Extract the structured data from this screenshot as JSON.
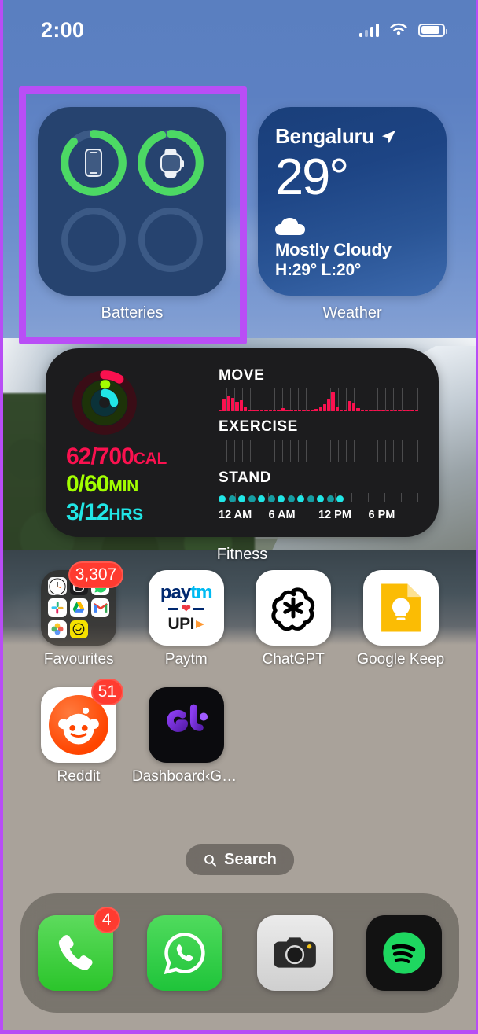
{
  "status_bar": {
    "time": "2:00",
    "cellular_icon": "cellular-signal-icon",
    "wifi_icon": "wifi-icon",
    "battery_icon": "battery-icon"
  },
  "widgets": {
    "batteries": {
      "label": "Batteries",
      "highlighted": true,
      "highlight_color": "#b94ef6",
      "rings": [
        {
          "device": "iphone",
          "icon": "iphone-icon",
          "percent": 88,
          "color": "#4cd964",
          "filled": true
        },
        {
          "device": "apple-watch",
          "icon": "apple-watch-icon",
          "percent": 95,
          "color": "#4cd964",
          "filled": true
        },
        {
          "device": "empty-slot-1",
          "icon": "",
          "percent": 0,
          "color": "#3c5a86",
          "filled": false
        },
        {
          "device": "empty-slot-2",
          "icon": "",
          "percent": 0,
          "color": "#3c5a86",
          "filled": false
        }
      ]
    },
    "weather": {
      "label": "Weather",
      "city": "Bengaluru",
      "location_icon": "location-arrow-icon",
      "temperature": "29°",
      "condition_icon": "cloud-icon",
      "condition": "Mostly Cloudy",
      "high_low": "H:29° L:20°"
    },
    "fitness": {
      "label": "Fitness",
      "move_value": "62/700",
      "move_unit": "CAL",
      "move_color": "#fa114f",
      "exercise_value": "0/60",
      "exercise_unit": "MIN",
      "exercise_color": "#a2ff00",
      "stand_value": "3/12",
      "stand_unit": "HRS",
      "stand_color": "#21e6e6",
      "move_header": "MOVE",
      "exercise_header": "EXERCISE",
      "stand_header": "STAND",
      "axis": [
        "12 AM",
        "6 AM",
        "12 PM",
        "6 PM"
      ],
      "rings": [
        {
          "name": "move-ring",
          "color": "#fa114f",
          "percent": 9
        },
        {
          "name": "exercise-ring",
          "color": "#a2ff00",
          "percent": 1
        },
        {
          "name": "stand-ring",
          "color": "#21e6e6",
          "percent": 25
        }
      ]
    }
  },
  "chart_data": [
    {
      "type": "bar",
      "title": "MOVE",
      "xlabel": "",
      "ylabel": "calories",
      "ylim": [
        0,
        100
      ],
      "categories": [
        "12 AM",
        "6 AM",
        "12 PM",
        "6 PM"
      ],
      "color": "#fa114f",
      "values": [
        5,
        52,
        66,
        58,
        40,
        48,
        22,
        9,
        7,
        6,
        6,
        5,
        6,
        5,
        9,
        14,
        8,
        6,
        6,
        6,
        5,
        6,
        7,
        10,
        16,
        30,
        52,
        82,
        20,
        5,
        4,
        44,
        36,
        14,
        6,
        5,
        5,
        4,
        4,
        4,
        5,
        4,
        4,
        4,
        4,
        4,
        4,
        4
      ]
    },
    {
      "type": "bar",
      "title": "EXERCISE",
      "xlabel": "",
      "ylabel": "minutes",
      "ylim": [
        0,
        100
      ],
      "categories": [
        "12 AM",
        "6 AM",
        "12 PM",
        "6 PM"
      ],
      "color": "#a2ff00",
      "values": [
        4,
        4,
        4,
        4,
        4,
        4,
        4,
        4,
        4,
        4,
        4,
        4,
        4,
        4,
        4,
        4,
        4,
        4,
        4,
        4,
        4,
        4,
        4,
        4,
        4,
        4,
        4,
        4,
        4,
        4,
        4,
        4,
        4,
        4,
        4,
        4,
        4,
        4,
        4,
        4,
        4,
        4,
        4,
        4,
        4,
        4,
        4,
        4
      ]
    },
    {
      "type": "scatter",
      "title": "STAND",
      "xlabel": "",
      "ylabel": "stand hours",
      "categories": [
        "12 AM",
        "6 AM",
        "12 PM",
        "6 PM"
      ],
      "color": "#21e6e6",
      "filled_dots": 13,
      "total_slots": 24,
      "values": [
        1,
        1,
        1,
        1,
        1,
        1,
        1,
        1,
        1,
        1,
        1,
        1,
        1,
        0,
        0,
        0,
        0,
        0,
        0,
        0,
        0,
        0,
        0,
        0
      ]
    }
  ],
  "apps": {
    "row1": [
      {
        "name": "Favourites",
        "icon": "folder-icon",
        "badge": "3,307",
        "mini_icons": [
          "clock-icon",
          "shortcuts-icon",
          "whatsapp-business-icon",
          "slack-icon",
          "google-drive-icon",
          "gmail-icon",
          "photos-icon",
          "vibe-icon"
        ]
      },
      {
        "name": "Paytm",
        "icon": "paytm-icon",
        "badge": "",
        "brand_top": "paytm",
        "brand_bottom": "UPI"
      },
      {
        "name": "ChatGPT",
        "icon": "chatgpt-icon",
        "badge": ""
      },
      {
        "name": "Google Keep",
        "icon": "google-keep-icon",
        "badge": ""
      }
    ],
    "row2": [
      {
        "name": "Reddit",
        "icon": "reddit-icon",
        "badge": "51"
      },
      {
        "name": "Dashboard‹Gu...",
        "icon": "dashboard-icon",
        "badge": ""
      }
    ]
  },
  "search": {
    "label": "Search",
    "icon": "search-icon"
  },
  "dock": [
    {
      "name": "Phone",
      "icon": "phone-icon",
      "badge": "4"
    },
    {
      "name": "WhatsApp",
      "icon": "whatsapp-icon",
      "badge": ""
    },
    {
      "name": "Camera",
      "icon": "camera-icon",
      "badge": ""
    },
    {
      "name": "Spotify",
      "icon": "spotify-icon",
      "badge": ""
    }
  ]
}
